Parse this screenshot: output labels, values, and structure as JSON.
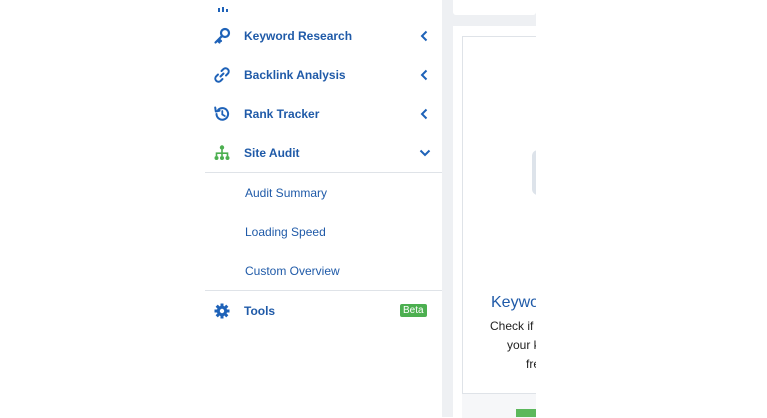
{
  "sidebar": {
    "items": [
      {
        "label": "Keyword Research",
        "icon": "key-icon",
        "expanded": false
      },
      {
        "label": "Backlink Analysis",
        "icon": "link-icon",
        "expanded": false
      },
      {
        "label": "Rank Tracker",
        "icon": "history-icon",
        "expanded": false
      },
      {
        "label": "Site Audit",
        "icon": "sitemap-icon",
        "expanded": true,
        "children": [
          {
            "label": "Audit Summary"
          },
          {
            "label": "Loading Speed"
          },
          {
            "label": "Custom Overview"
          }
        ]
      },
      {
        "label": "Tools",
        "icon": "gear-icon",
        "badge": "Beta"
      }
    ]
  },
  "card": {
    "title": "Keywo",
    "text_lines": [
      "Check if",
      "your k",
      "fre"
    ]
  },
  "colors": {
    "accent": "#1f5aa8",
    "icon_blue": "#1e62b8",
    "icon_green": "#4caf50",
    "badge": "#4caf50",
    "content_bg": "#eef0f3"
  }
}
